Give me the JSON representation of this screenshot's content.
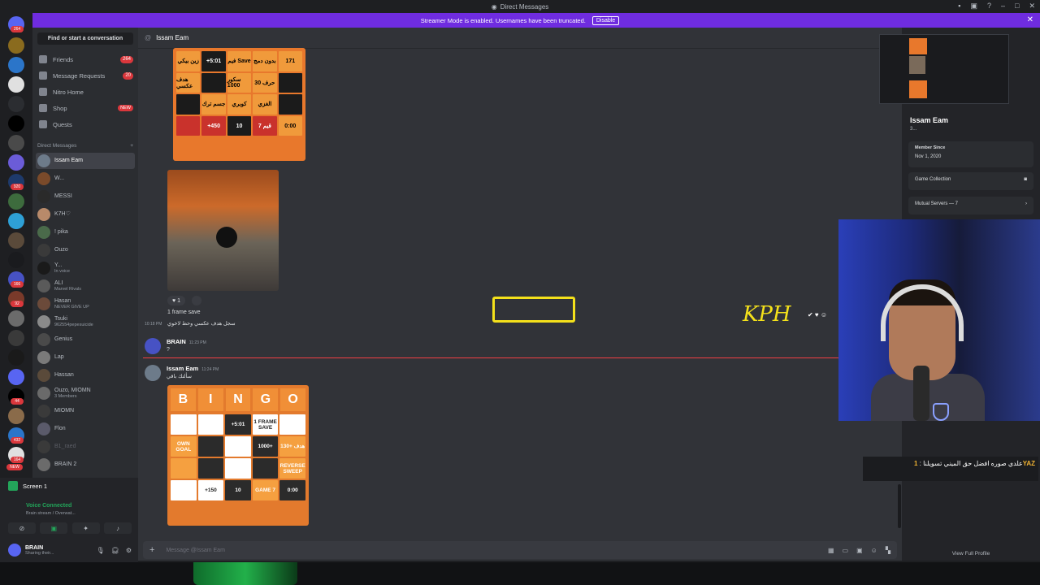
{
  "titlebar": {
    "title": "Direct Messages"
  },
  "banner": {
    "text": "Streamer Mode is enabled. Usernames have been truncated.",
    "button": "Disable"
  },
  "guild_badges": [
    "264",
    "920",
    "166",
    "92",
    "44",
    "432",
    "164",
    "NEW"
  ],
  "sidebar": {
    "search": "Find or start a conversation",
    "nav": [
      {
        "label": "Friends",
        "count": "264"
      },
      {
        "label": "Message Requests",
        "count": "20"
      },
      {
        "label": "Nitro Home",
        "count": ""
      },
      {
        "label": "Shop",
        "count": "NEW"
      },
      {
        "label": "Quests",
        "count": ""
      }
    ],
    "dm_header": "Direct Messages",
    "dms": [
      {
        "name": "Issam Eam",
        "sub": ""
      },
      {
        "name": "W...",
        "sub": ""
      },
      {
        "name": "MESSI",
        "sub": ""
      },
      {
        "name": "K7H♡",
        "sub": ""
      },
      {
        "name": "! pika",
        "sub": ""
      },
      {
        "name": "Ouzo",
        "sub": ""
      },
      {
        "name": "Y...",
        "sub": "In voice"
      },
      {
        "name": "ALI",
        "sub": "Marvel Rivals"
      },
      {
        "name": "Hasan",
        "sub": "NEVER GIVE UP"
      },
      {
        "name": "Tsuki",
        "sub": "962554pepesuicide"
      },
      {
        "name": "Genius",
        "sub": ""
      },
      {
        "name": "Lap",
        "sub": ""
      },
      {
        "name": "Hassan",
        "sub": ""
      },
      {
        "name": "Ouzo, MIOMN",
        "sub": "3 Members"
      },
      {
        "name": "MIOMN",
        "sub": ""
      },
      {
        "name": "Flon",
        "sub": ""
      },
      {
        "name": "B1_raed",
        "sub": ""
      },
      {
        "name": "BRAIN 2",
        "sub": ""
      }
    ]
  },
  "voice": {
    "screen": "Screen 1",
    "status": "Voice Connected",
    "sub": "Brain stream / Overwat..."
  },
  "user": {
    "name": "BRAIN",
    "status": "Sharing their..."
  },
  "chat": {
    "header_name": "Issam Eam",
    "reaction_count": "1",
    "caption": "1 frame save",
    "time_1": "10:18 PM",
    "arabic_line": "سجل هدف عكسي وحط لاخوي",
    "msg2": {
      "name": "BRAIN",
      "time": "11:23 PM",
      "text": "?"
    },
    "msg3": {
      "name": "Issam Eam",
      "time": "11:24 PM",
      "text": "سألتك باقي"
    },
    "composer_placeholder": "Message @Issam Eam"
  },
  "bingo1_cells": [
    "زين بيكي",
    "+5:01",
    "فيم Save",
    "بدون دمج",
    "171",
    "هدف عكسي",
    "",
    "سكور 1000",
    "حرف 30",
    "",
    "",
    "جسم ترك",
    "كوبري",
    "الغزي",
    "",
    "",
    "+450",
    "10",
    "قيم 7",
    "0:00"
  ],
  "bingo2": {
    "header": [
      "B",
      "I",
      "N",
      "G",
      "O"
    ],
    "cells": [
      "",
      "",
      "+5:01",
      "1 FRAME SAVE",
      "",
      "OWN GOAL",
      "",
      "",
      "1000+",
      "هدف +130",
      "",
      "",
      "",
      "",
      "REVERSE SWEEP",
      "",
      "+150",
      "10",
      "GAME 7",
      "0:00"
    ]
  },
  "annotation": {
    "text": "KPH"
  },
  "profile": {
    "name": "Issam Eam",
    "sub": "3...",
    "member_since_label": "Member Since",
    "member_since": "Nov 1, 2020",
    "game_collection": "Game Collection",
    "mutual_servers": "Mutual Servers — 7",
    "view_full": "View Full Profile"
  },
  "stream_chat": {
    "user": "1YAZ",
    "message": "علدي صوره افضل حق الميني تسويلنا"
  },
  "colors": {
    "brand": "#5865f2",
    "banner": "#6f2ce0",
    "badge": "#da373c",
    "online": "#23a55a",
    "annotation": "#f4e11b"
  }
}
